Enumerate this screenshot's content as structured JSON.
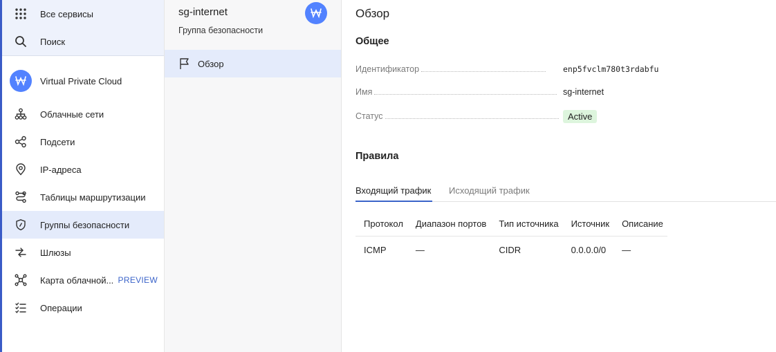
{
  "sidebar": {
    "all_services": "Все сервисы",
    "search": "Поиск",
    "service_name": "Virtual Private Cloud",
    "items": [
      {
        "label": "Облачные сети",
        "icon": "network-icon"
      },
      {
        "label": "Подсети",
        "icon": "subnets-icon"
      },
      {
        "label": "IP-адреса",
        "icon": "location-pin-icon"
      },
      {
        "label": "Таблицы маршрутизации",
        "icon": "route-icon"
      },
      {
        "label": "Группы безопасности",
        "icon": "shield-icon",
        "active": true
      },
      {
        "label": "Шлюзы",
        "icon": "arrows-icon"
      },
      {
        "label": "Карта облачной...",
        "icon": "map-graph-icon",
        "badge": "PREVIEW"
      },
      {
        "label": "Операции",
        "icon": "list-check-icon"
      }
    ]
  },
  "resource": {
    "name": "sg-internet",
    "type": "Группа безопасности",
    "nav": [
      {
        "label": "Обзор",
        "icon": "flag-icon",
        "active": true
      }
    ]
  },
  "main": {
    "title": "Обзор",
    "general_heading": "Общее",
    "fields": {
      "id_label": "Идентификатор",
      "id_value": "enp5fvclm780t3rdabfu",
      "name_label": "Имя",
      "name_value": "sg-internet",
      "status_label": "Статус",
      "status_value": "Active"
    },
    "rules_heading": "Правила",
    "tabs": [
      {
        "label": "Входящий трафик",
        "active": true
      },
      {
        "label": "Исходящий трафик",
        "active": false
      }
    ],
    "table": {
      "columns": [
        "Протокол",
        "Диапазон портов",
        "Тип источника",
        "Источник",
        "Описание"
      ],
      "rows": [
        [
          "ICMP",
          "—",
          "CIDR",
          "0.0.0.0/0",
          "—"
        ]
      ]
    }
  },
  "colors": {
    "accent": "#3a63c9",
    "logo_bg": "#5282ff",
    "active_bg": "#e4ebfb",
    "status_bg": "#ddf5dd",
    "status_text": "#2e8b3a"
  }
}
